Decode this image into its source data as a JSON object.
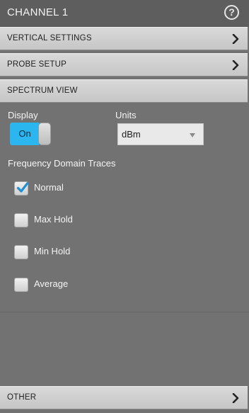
{
  "header": {
    "title": "CHANNEL 1",
    "help_symbol": "?",
    "help_icon": "help-circle-icon"
  },
  "sections": {
    "vertical_settings": "VERTICAL SETTINGS",
    "probe_setup": "PROBE SETUP",
    "spectrum_view": "SPECTRUM VIEW",
    "other": "OTHER",
    "chevron_icon": "chevron-right-icon"
  },
  "display": {
    "label": "Display",
    "toggle_state": "On"
  },
  "units": {
    "label": "Units",
    "selected": "dBm"
  },
  "traces": {
    "heading": "Frequency Domain Traces",
    "items": [
      {
        "label": "Normal",
        "checked": true
      },
      {
        "label": "Max Hold",
        "checked": false
      },
      {
        "label": "Min Hold",
        "checked": false
      },
      {
        "label": "Average",
        "checked": false
      }
    ]
  },
  "colors": {
    "accent": "#2bb6ef",
    "check": "#1f8fd6",
    "panel_bg": "#727272",
    "header_bg": "#5e5e5e"
  }
}
